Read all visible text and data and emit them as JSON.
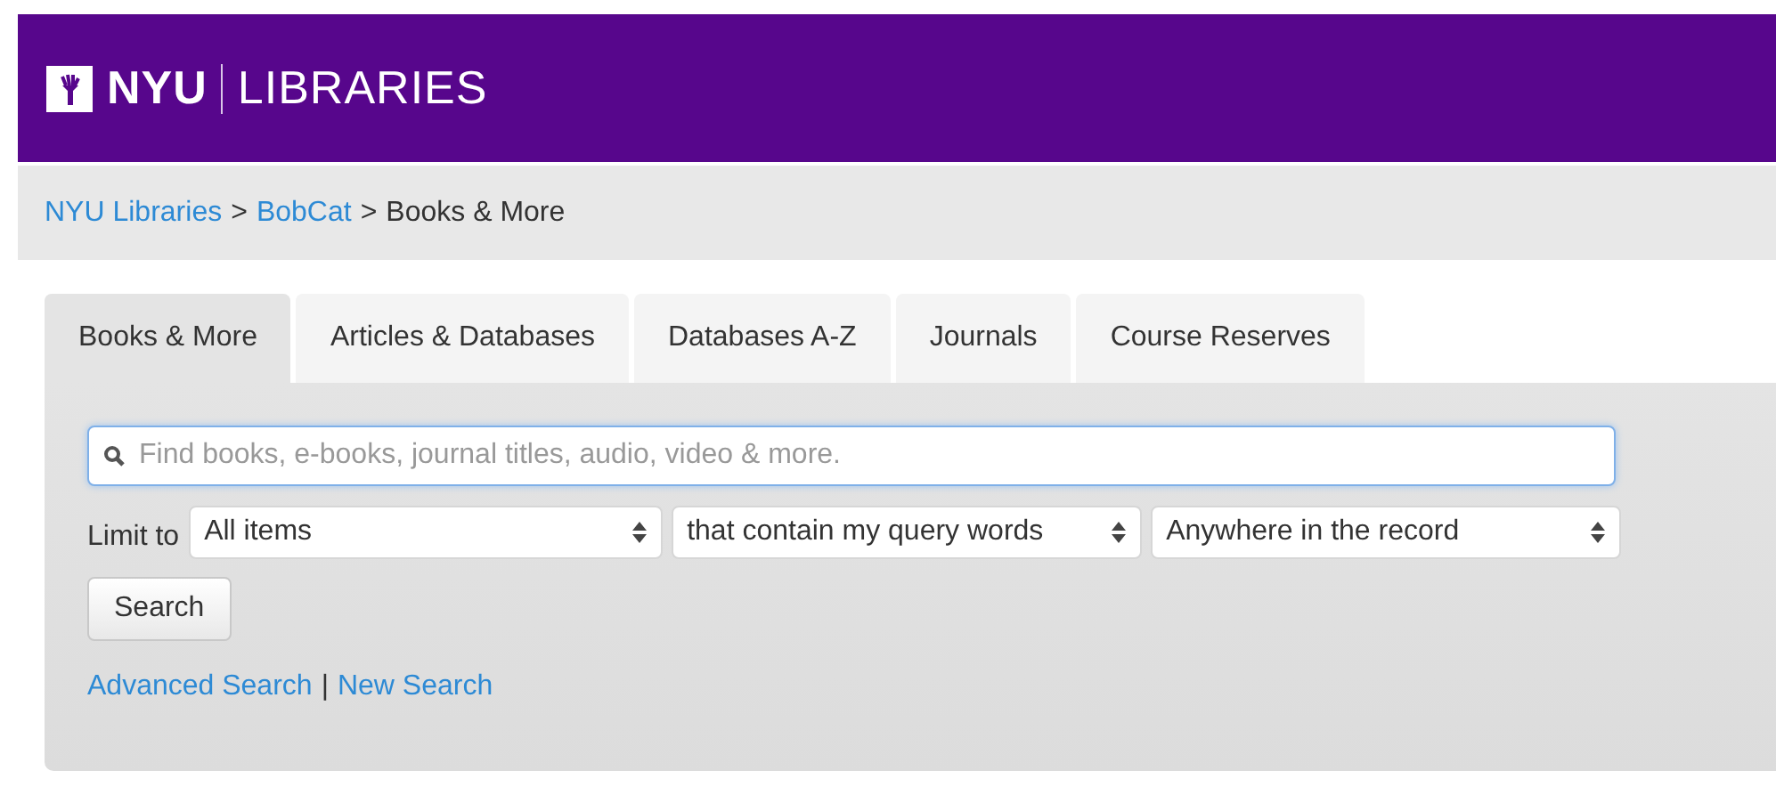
{
  "header": {
    "logo_main": "NYU",
    "logo_sub": "LIBRARIES"
  },
  "breadcrumb": [
    {
      "label": "NYU Libraries",
      "link": true
    },
    {
      "label": ">",
      "link": false
    },
    {
      "label": "BobCat",
      "link": true
    },
    {
      "label": ">",
      "link": false
    },
    {
      "label": "Books & More",
      "link": false
    }
  ],
  "tabs": [
    {
      "label": "Books & More",
      "selected": true
    },
    {
      "label": "Articles & Databases",
      "selected": false
    },
    {
      "label": "Databases A-Z",
      "selected": false
    },
    {
      "label": "Journals",
      "selected": false
    },
    {
      "label": "Course Reserves",
      "selected": false
    }
  ],
  "search": {
    "placeholder": "Find books, e-books, journal titles, audio, video & more."
  },
  "limit": {
    "label": "Limit to",
    "selects": [
      "All items",
      "that contain my query words",
      "Anywhere in the record"
    ]
  },
  "search_button": "Search",
  "links": [
    {
      "label": "Advanced Search"
    },
    {
      "label": "|"
    },
    {
      "label": "New Search"
    }
  ]
}
